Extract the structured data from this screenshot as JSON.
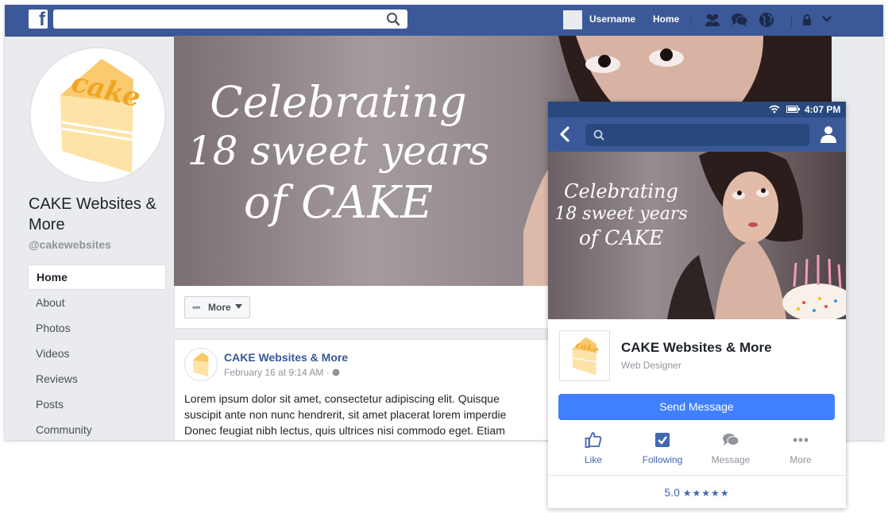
{
  "colors": {
    "brand": "#3b5998",
    "brand_dark": "#29487d",
    "link": "#365899",
    "button_blue": "#4080ff",
    "cake_orange": "#f6b63f",
    "cake_cream": "#fde3a7"
  },
  "desktop": {
    "topbar": {
      "username": "Username",
      "home": "Home",
      "icons": [
        "facebook-logo-icon",
        "search-icon",
        "friends-icon",
        "messages-icon",
        "globe-icon",
        "lock-icon",
        "chevron-down-icon"
      ]
    },
    "profile": {
      "logo_text": "cake",
      "name_line1": "CAKE Websites &",
      "name_line2": "More",
      "handle": "@cakewebsites"
    },
    "sidebar": {
      "items": [
        {
          "label": "Home"
        },
        {
          "label": "About"
        },
        {
          "label": "Photos"
        },
        {
          "label": "Videos"
        },
        {
          "label": "Reviews"
        },
        {
          "label": "Posts"
        },
        {
          "label": "Community"
        }
      ]
    },
    "cover": {
      "line1": "Celebrating",
      "line2": "18 sweet years",
      "line3": "of CAKE"
    },
    "action_bar": {
      "more_label": "More"
    },
    "post": {
      "author": "CAKE Websites & More",
      "time": "February 16 at 9:14 AM · ",
      "lines": [
        "Lorem ipsum dolor sit amet, consectetur adipiscing elit. Quisque",
        "suscipit ante non nunc hendrerit, sit amet placerat lorem imperdie",
        "Donec feugiat nibh lectus, quis ultrices nisi commodo eget. Etiam"
      ]
    }
  },
  "mobile": {
    "status": {
      "time": "4:07 PM",
      "icons": [
        "wifi-icon",
        "battery-icon"
      ]
    },
    "cover": {
      "line1": "Celebrating",
      "line2": "18 sweet years",
      "line3": "of CAKE"
    },
    "page": {
      "logo_text": "cake",
      "name": "CAKE Websites & More",
      "category": "Web Designer"
    },
    "send_message": "Send Message",
    "actions": [
      {
        "label": "Like",
        "icon": "thumbs-up-icon",
        "active": true
      },
      {
        "label": "Following",
        "icon": "check-box-icon",
        "active": true
      },
      {
        "label": "Message",
        "icon": "speech-bubbles-icon",
        "active": false
      },
      {
        "label": "More",
        "icon": "more-dots-icon",
        "active": false
      }
    ],
    "rating": {
      "value": "5.0",
      "stars": 5,
      "star_glyphs": "★★★★★"
    }
  }
}
